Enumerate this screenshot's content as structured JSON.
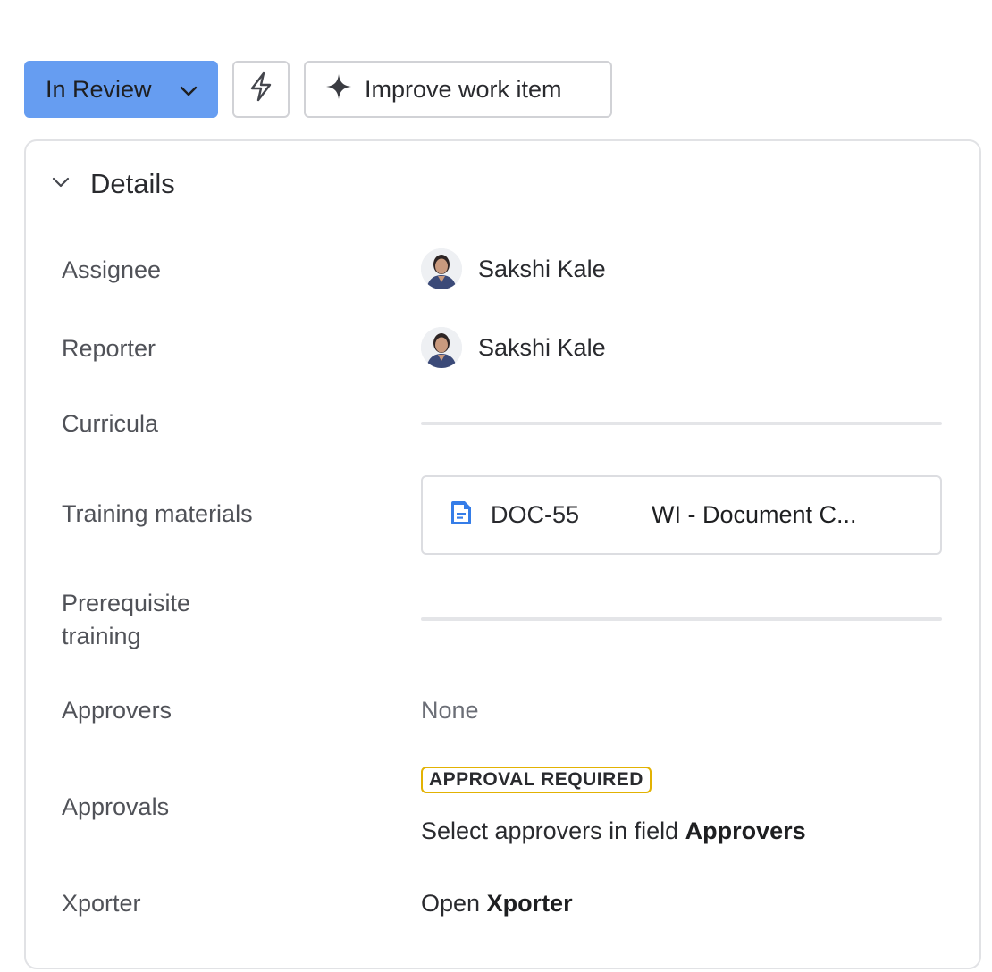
{
  "toolbar": {
    "status_label": "In Review",
    "status_icon": "chevron-down-icon",
    "automation_icon": "lightning-icon",
    "improve_icon": "sparkle-icon",
    "improve_label": "Improve work item",
    "status_color": "#669df1"
  },
  "details": {
    "title": "Details",
    "collapse_icon": "chevron-down-icon",
    "fields": {
      "assignee": {
        "label": "Assignee",
        "value": "Sakshi Kale"
      },
      "reporter": {
        "label": "Reporter",
        "value": "Sakshi Kale"
      },
      "curricula": {
        "label": "Curricula"
      },
      "training_materials": {
        "label": "Training materials",
        "doc_icon": "document-icon",
        "doc_key": "DOC-55",
        "doc_title": "WI - Document C..."
      },
      "prerequisite": {
        "label_line1": "Prerequisite",
        "label_line2": "training"
      },
      "approvers": {
        "label": "Approvers",
        "value": "None"
      },
      "approvals": {
        "label": "Approvals",
        "badge": "APPROVAL REQUIRED",
        "badge_color": "#e2b203",
        "hint_prefix": "Select approvers in field ",
        "hint_field": "Approvers"
      },
      "xporter": {
        "label": "Xporter",
        "prefix": "Open ",
        "link": "Xporter"
      }
    }
  }
}
